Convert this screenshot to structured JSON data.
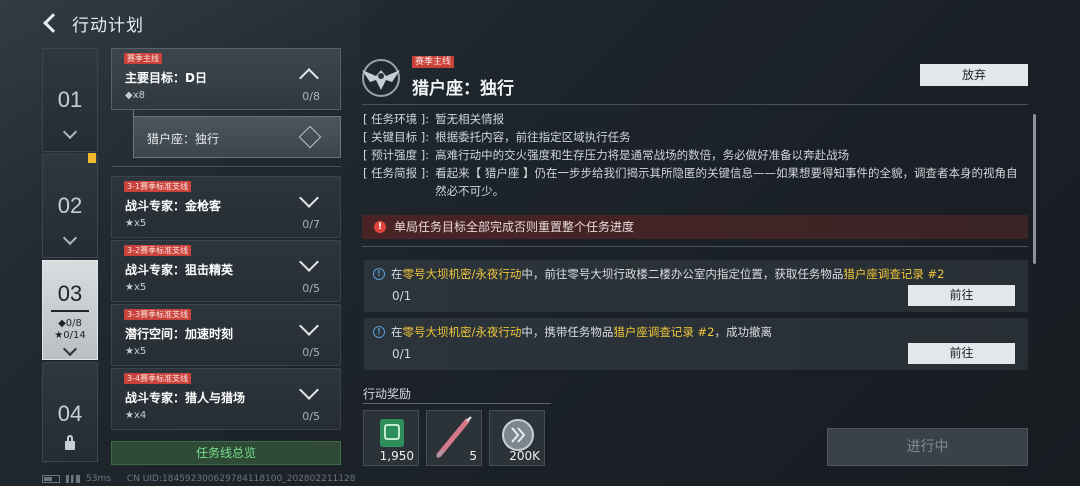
{
  "header": {
    "title": "行动计划"
  },
  "rail": {
    "items": [
      {
        "num": "01"
      },
      {
        "num": "02"
      },
      {
        "num": "03",
        "stat1": "◆0/8",
        "stat2": "★0/14"
      },
      {
        "num": "04"
      }
    ]
  },
  "tasks": {
    "main": {
      "tag": "赛季主线",
      "name": "主要目标：D日",
      "count": "◆x8",
      "progress": "0/8"
    },
    "sub": {
      "name": "猎户座：独行"
    },
    "list": [
      {
        "tag": "3-1赛季标准支线",
        "name": "战斗专家：金枪客",
        "count": "★x5",
        "progress": "0/7"
      },
      {
        "tag": "3-2赛季标准支线",
        "name": "战斗专家：狙击精英",
        "count": "★x5",
        "progress": "0/5"
      },
      {
        "tag": "3-3赛季标准支线",
        "name": "潜行空间：加速时刻",
        "count": "★x5",
        "progress": "0/5"
      },
      {
        "tag": "3-4赛季标准支线",
        "name": "战斗专家：猎人与猎场",
        "count": "★x4",
        "progress": "0/5"
      }
    ],
    "overview_label": "任务线总览"
  },
  "detail": {
    "tag": "赛季主线",
    "title": "猎户座：独行",
    "abandon_label": "放弃",
    "info": [
      {
        "label": "[ 任务环境 ]:",
        "text": "暂无相关情报"
      },
      {
        "label": "[ 关键目标 ]:",
        "text": "根据委托内容，前往指定区域执行任务"
      },
      {
        "label": "[ 预计强度 ]:",
        "text": "高难行动中的交火强度和生存压力将是通常战场的数倍，务必做好准备以奔赴战场"
      },
      {
        "label": "[ 任务简报 ]:",
        "text": "看起来【 猎户座 】仍在一步步给我们揭示其所隐匿的关键信息——如果想要得知事件的全貌，调查者本身的视角自然必不可少。"
      }
    ],
    "reset_notice": "单局任务目标全部完成否则重置整个任务进度",
    "objectives": [
      {
        "pre": "在",
        "hl1": "零号大坝机密/永夜行动",
        "mid": "中，前往零号大坝行政楼二楼办公室内指定位置，获取任务物品",
        "hl2": "猎户座调查记录 #2",
        "post": "",
        "progress": "0/1",
        "button": "前往"
      },
      {
        "pre": "在",
        "hl1": "零号大坝机密/永夜行动",
        "mid": "中，携带任务物品",
        "hl2": "猎户座调查记录 #2",
        "post": "，成功撤离",
        "progress": "0/1",
        "button": "前往"
      }
    ],
    "rewards_label": "行动奖励",
    "rewards": [
      {
        "icon": "green-box-icon",
        "qty": "1,950"
      },
      {
        "icon": "syringe-icon",
        "qty": "5"
      },
      {
        "icon": "coin-icon",
        "qty": "200K"
      }
    ],
    "status_button": "进行中"
  },
  "footer": {
    "ping": "53ms",
    "uid": "CN UID:18459230062978411810​0_20280221​1128"
  },
  "colors": {
    "accent_red": "#c9423a",
    "highlight": "#f0c63a",
    "green": "#76e08a"
  }
}
